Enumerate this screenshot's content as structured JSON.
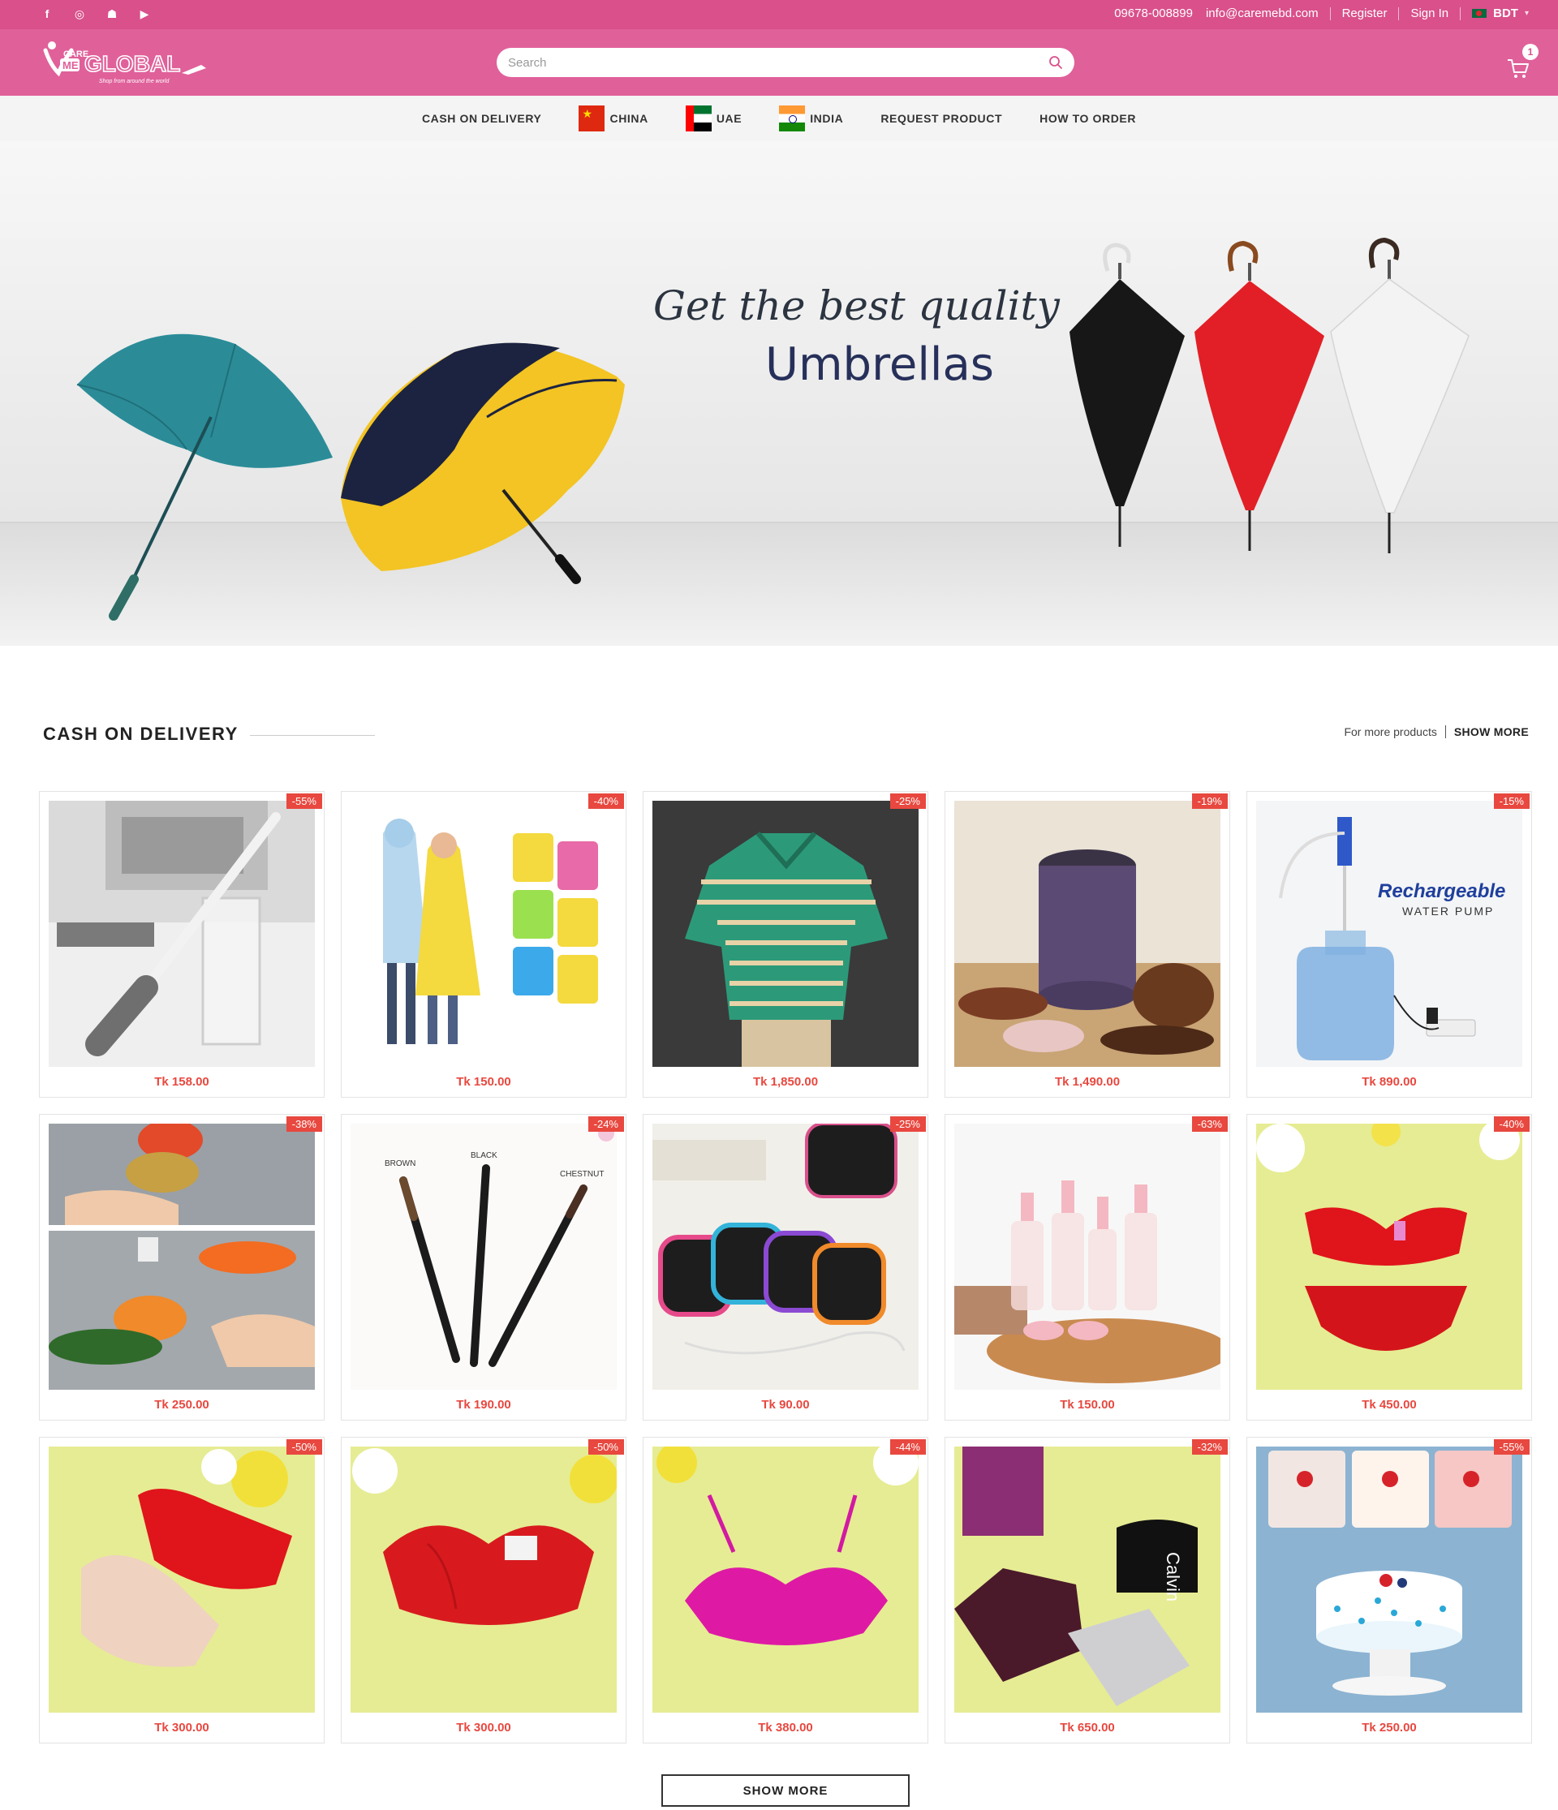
{
  "topbar": {
    "social": [
      {
        "icon": "facebook-icon",
        "glyph": "f"
      },
      {
        "icon": "instagram-icon",
        "glyph": "◎"
      },
      {
        "icon": "snapchat-icon",
        "glyph": "☗"
      },
      {
        "icon": "youtube-icon",
        "glyph": "▶"
      }
    ],
    "phone": "09678-008899",
    "email": "info@caremebd.com",
    "register": "Register",
    "sign_in": "Sign In",
    "currency": "BDT"
  },
  "header": {
    "logo_care": "CARE",
    "logo_me": "ME",
    "logo_global": "GLOBAL",
    "logo_tagline": "Shop from around the world",
    "search_placeholder": "Search",
    "cart_count": "1"
  },
  "nav": {
    "items": [
      {
        "label": "CASH ON DELIVERY",
        "flag": ""
      },
      {
        "label": "CHINA",
        "flag": "china-flag"
      },
      {
        "label": "UAE",
        "flag": "uae-flag"
      },
      {
        "label": "INDIA",
        "flag": "india-flag"
      },
      {
        "label": "REQUEST PRODUCT",
        "flag": ""
      },
      {
        "label": "HOW TO ORDER",
        "flag": ""
      }
    ]
  },
  "hero": {
    "script_text": "Get the best quality",
    "title": "Umbrellas"
  },
  "section": {
    "title": "CASH ON DELIVERY",
    "more_text": "For more products",
    "show_more": "SHOW MORE"
  },
  "products": [
    {
      "discount": "-55%",
      "price": "Tk 158.00",
      "art": "brush"
    },
    {
      "discount": "-40%",
      "price": "Tk 150.00",
      "art": "raincoat"
    },
    {
      "discount": "-25%",
      "price": "Tk 1,850.00",
      "art": "polo"
    },
    {
      "discount": "-19%",
      "price": "Tk 1,490.00",
      "art": "grinder"
    },
    {
      "discount": "-15%",
      "price": "Tk 890.00",
      "art": "pump",
      "overlay_title": "Rechargeable",
      "overlay_sub": "WATER PUMP"
    },
    {
      "discount": "-38%",
      "price": "Tk 250.00",
      "art": "veggies"
    },
    {
      "discount": "-24%",
      "price": "Tk 190.00",
      "art": "pencils",
      "labels": [
        "BROWN",
        "BLACK",
        "CHESTNUT"
      ]
    },
    {
      "discount": "-25%",
      "price": "Tk 90.00",
      "art": "cases"
    },
    {
      "discount": "-63%",
      "price": "Tk 150.00",
      "art": "bottles"
    },
    {
      "discount": "-40%",
      "price": "Tk 450.00",
      "art": "redset"
    },
    {
      "discount": "-50%",
      "price": "Tk 300.00",
      "art": "bra-red-white"
    },
    {
      "discount": "-50%",
      "price": "Tk 300.00",
      "art": "bra-red"
    },
    {
      "discount": "-44%",
      "price": "Tk 380.00",
      "art": "bra-pink"
    },
    {
      "discount": "-32%",
      "price": "Tk 650.00",
      "art": "briefs",
      "brand": "Calvin"
    },
    {
      "discount": "-55%",
      "price": "Tk 250.00",
      "art": "cake"
    }
  ],
  "bottom_button": "SHOW MORE",
  "colors": {
    "topbar": "#d9508b",
    "header": "#e0609a",
    "discount": "#e8483f",
    "price": "#e8483f"
  }
}
